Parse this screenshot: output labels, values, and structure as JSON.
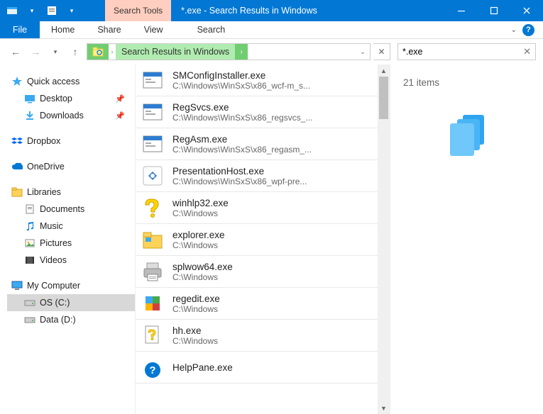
{
  "titlebar": {
    "search_tools_label": "Search Tools",
    "title": "*.exe - Search Results in Windows"
  },
  "ribbon": {
    "file": "File",
    "home": "Home",
    "share": "Share",
    "view": "View",
    "search": "Search"
  },
  "address": {
    "crumb": "Search Results in Windows"
  },
  "search": {
    "value": "*.exe"
  },
  "navpane": {
    "quick_access": "Quick access",
    "desktop": "Desktop",
    "downloads": "Downloads",
    "dropbox": "Dropbox",
    "onedrive": "OneDrive",
    "libraries": "Libraries",
    "documents": "Documents",
    "music": "Music",
    "pictures": "Pictures",
    "videos": "Videos",
    "my_computer": "My Computer",
    "os_c": "OS (C:)",
    "data_d": "Data (D:)"
  },
  "results": [
    {
      "name": "SMConfigInstaller.exe",
      "path": "C:\\Windows\\WinSxS\\x86_wcf-m_s...",
      "icon": "app"
    },
    {
      "name": "RegSvcs.exe",
      "path": "C:\\Windows\\WinSxS\\x86_regsvcs_...",
      "icon": "app"
    },
    {
      "name": "RegAsm.exe",
      "path": "C:\\Windows\\WinSxS\\x86_regasm_...",
      "icon": "app"
    },
    {
      "name": "PresentationHost.exe",
      "path": "C:\\Windows\\WinSxS\\x86_wpf-pre...",
      "icon": "wpf"
    },
    {
      "name": "winhlp32.exe",
      "path": "C:\\Windows",
      "icon": "help-yellow"
    },
    {
      "name": "explorer.exe",
      "path": "C:\\Windows",
      "icon": "explorer"
    },
    {
      "name": "splwow64.exe",
      "path": "C:\\Windows",
      "icon": "printer"
    },
    {
      "name": "regedit.exe",
      "path": "C:\\Windows",
      "icon": "regedit"
    },
    {
      "name": "hh.exe",
      "path": "C:\\Windows",
      "icon": "hh"
    },
    {
      "name": "HelpPane.exe",
      "path": "",
      "icon": "helppane"
    }
  ],
  "details": {
    "count_label": "21 items"
  }
}
